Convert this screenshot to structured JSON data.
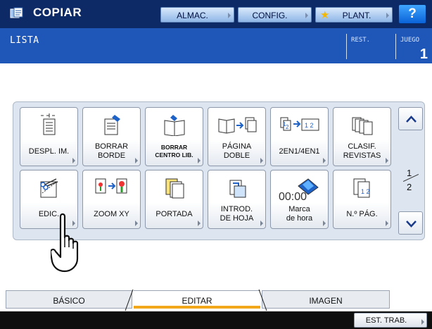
{
  "header": {
    "title": "COPIAR",
    "app_icon": "copy-app-icon",
    "buttons": {
      "almac": "ALMAC.",
      "config": "CONFIG.",
      "plant": "PLANT.",
      "help": "?"
    }
  },
  "status": {
    "message": "LISTA",
    "rest_label": "REST.",
    "juego_label": "JUEGO",
    "juego_value": "1"
  },
  "functions": [
    {
      "label": "DESPL. IM.",
      "icon": "image-shift-icon"
    },
    {
      "label": "BORRAR\nBORDE",
      "icon": "edge-erase-icon"
    },
    {
      "label": "BORRAR\nCENTRO LIB.",
      "icon": "book-center-erase-icon"
    },
    {
      "label": "PÁGINA\nDOBLE",
      "icon": "dual-page-icon"
    },
    {
      "label": "2EN1/4EN1",
      "icon": "2in1-4in1-icon"
    },
    {
      "label": "CLASIF.\nREVISTAS",
      "icon": "magazine-sort-icon"
    },
    {
      "label": "EDIC.",
      "icon": "editing-scissors-icon"
    },
    {
      "label": "ZOOM XY",
      "icon": "xy-zoom-icon"
    },
    {
      "label": "PORTADA",
      "icon": "cover-sheet-icon"
    },
    {
      "label": "INTROD.\nDE HOJA",
      "icon": "sheet-insertion-icon"
    },
    {
      "label": "Marca\nde hora",
      "icon": "time-stamp-icon"
    },
    {
      "label": "N.º PÁG.",
      "icon": "page-number-icon"
    }
  ],
  "time_stamp_icon_text": "00:00",
  "page_indicator": {
    "current": "1",
    "total": "2"
  },
  "tabs": {
    "basico": "BÁSICO",
    "editar": "EDITAR",
    "imagen": "IMAGEN",
    "active": "EDITAR"
  },
  "footer": {
    "job_status": "EST. TRAB."
  },
  "colors": {
    "header_bg": "#0d2a66",
    "status_bg": "#1f57b8",
    "active_tab_underline": "#f2a71a",
    "help_button": "#0a62d8"
  }
}
